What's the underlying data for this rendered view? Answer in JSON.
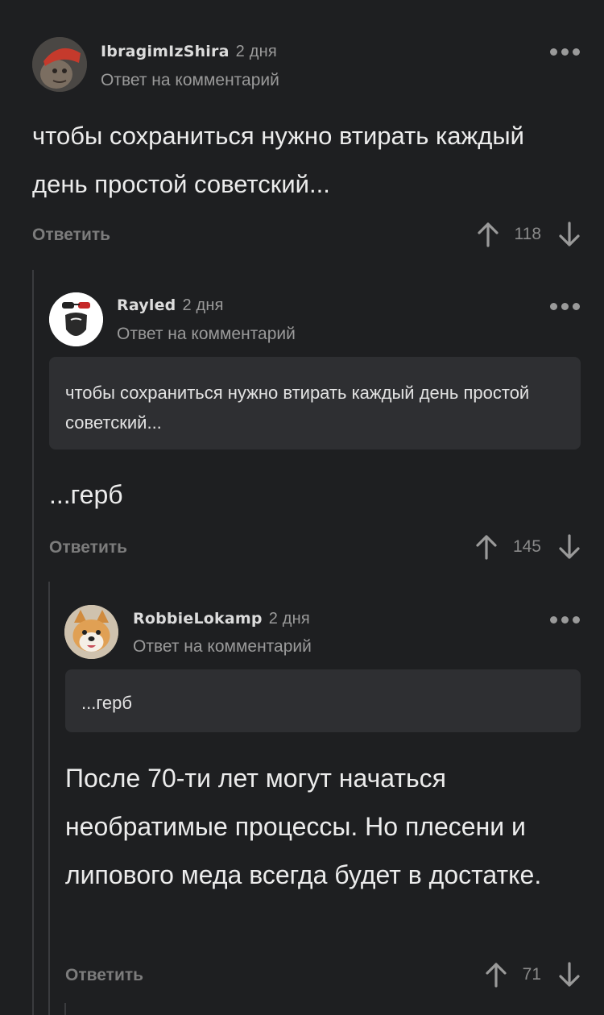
{
  "comments": [
    {
      "author": "IbragimIzShira",
      "time": "2 дня",
      "subline": "Ответ на комментарий",
      "body": "чтобы сохраниться нужно втирать каждый день простой советский...",
      "reply_label": "Ответить",
      "rating": "118"
    },
    {
      "author": "Rayled",
      "time": "2 дня",
      "subline": "Ответ на комментарий",
      "quote": "чтобы сохраниться нужно втирать каждый день простой советский...",
      "body": "...герб",
      "reply_label": "Ответить",
      "rating": "145"
    },
    {
      "author": "RobbieLokamp",
      "time": "2 дня",
      "subline": "Ответ на комментарий",
      "quote": "...герб",
      "body": "После 70-ти лет могут начаться необратимые процессы. Но плесени и липового меда всегда будет в достатке.",
      "reply_label": "Ответить",
      "rating": "71"
    }
  ],
  "colors": {
    "background": "#1e1f21",
    "quote_bg": "#2e2f32",
    "muted": "#9a9a9a"
  },
  "icons": [
    "more-dots-icon",
    "upvote-arrow-icon",
    "downvote-arrow-icon"
  ]
}
